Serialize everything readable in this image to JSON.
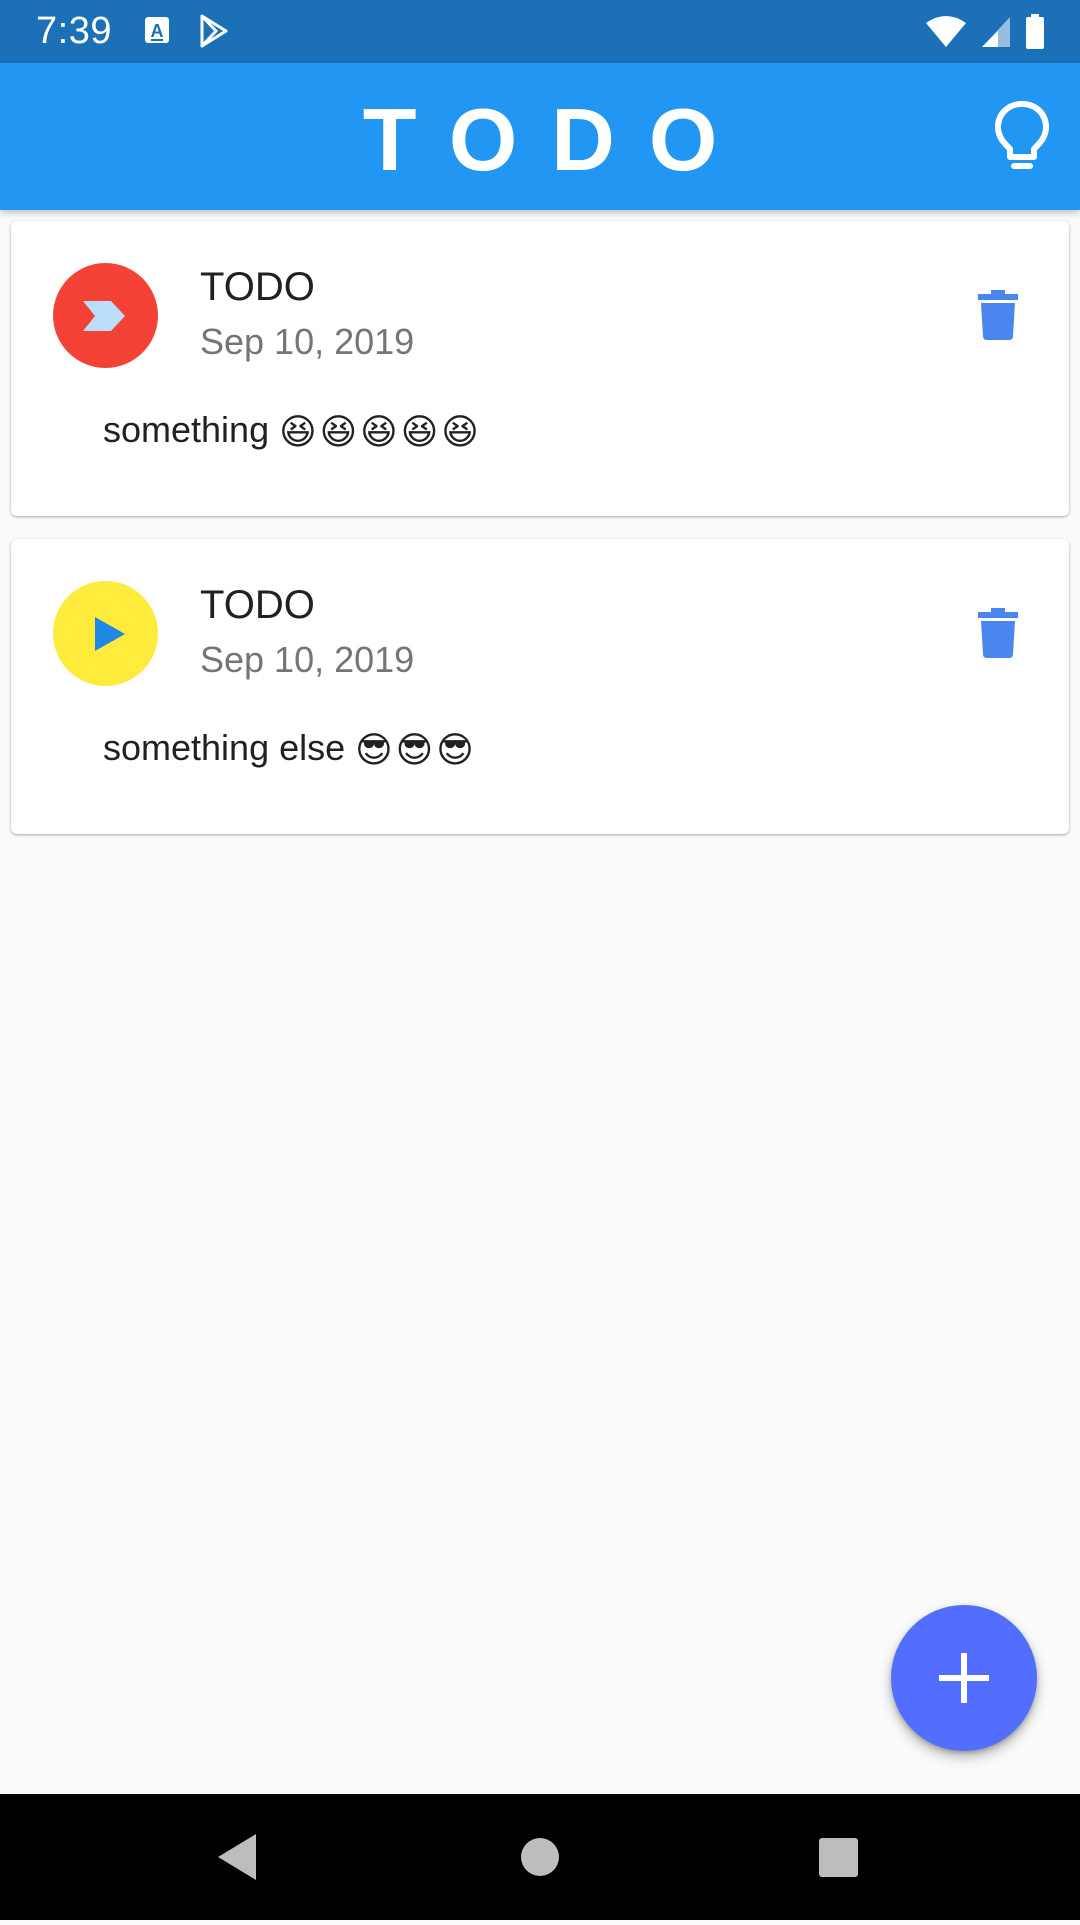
{
  "status_bar": {
    "time": "7:39",
    "left_icons": [
      "keyboard-a-icon",
      "play-store-icon"
    ],
    "right_icons": [
      "wifi-icon",
      "cell-signal-icon",
      "battery-icon"
    ]
  },
  "app_bar": {
    "title": "TODO",
    "action_icon": "lightbulb-icon"
  },
  "todos": [
    {
      "status_color": "#f44336",
      "status_icon": "chevron-right-icon",
      "title": "TODO",
      "date": "Sep 10, 2019",
      "text": "something",
      "emojis": [
        "😆",
        "😆",
        "😆",
        "😆",
        "😆"
      ],
      "action_icon": "delete-icon"
    },
    {
      "status_color": "#ffeb3b",
      "status_icon": "play-icon",
      "title": "TODO",
      "date": "Sep 10, 2019",
      "text": "something else",
      "emojis": [
        "😎",
        "😎",
        "😎"
      ],
      "action_icon": "delete-icon"
    }
  ],
  "fab": {
    "icon": "plus-icon",
    "color": "#536dfe"
  },
  "colors": {
    "status_bar": "#1c70b8",
    "app_bar": "#2196f3",
    "delete_icon": "#4a86f0",
    "background": "#fafafa"
  },
  "nav_bar": {
    "buttons": [
      "back-icon",
      "home-icon",
      "recents-icon"
    ]
  }
}
